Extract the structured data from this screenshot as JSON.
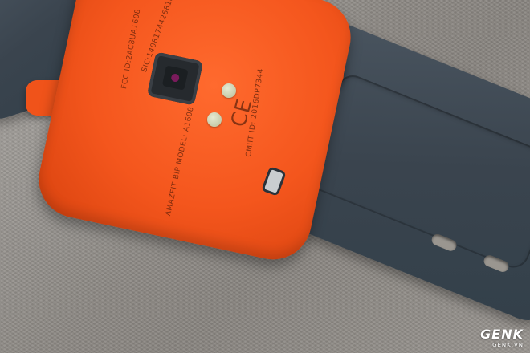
{
  "photo": {
    "case_engraving_lines": [
      "SIC:14081744268182 MADE IN CHINA",
      "FCC ID:2AC8UA1608",
      "AMAZFIT BIP MODEL: A1608",
      "CMIIT ID: 2016DP7344"
    ],
    "cert_marks": [
      "CE"
    ],
    "colors": {
      "case": "#f4561d",
      "strap": "#3a444e",
      "fabric": "#8f8b86"
    }
  },
  "watermark": {
    "logo": "GENK",
    "site": "GENK.VN"
  }
}
